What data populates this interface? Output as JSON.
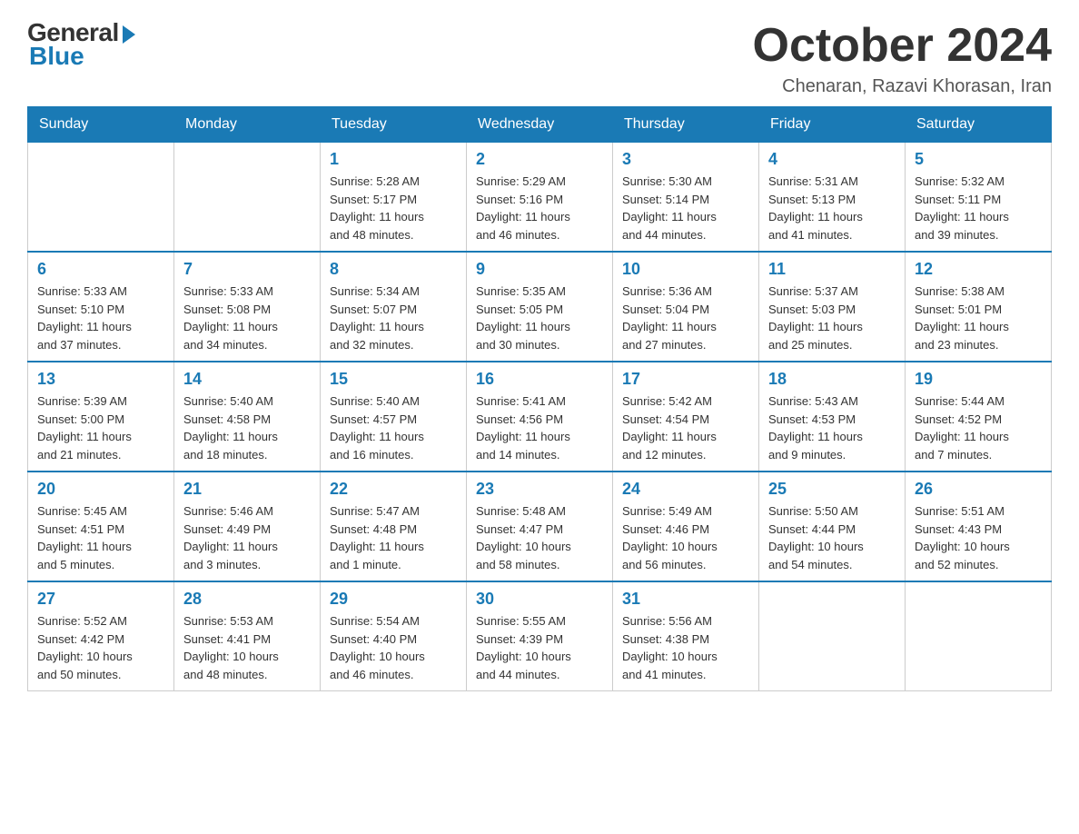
{
  "logo": {
    "general": "General",
    "blue": "Blue"
  },
  "title": "October 2024",
  "location": "Chenaran, Razavi Khorasan, Iran",
  "days_of_week": [
    "Sunday",
    "Monday",
    "Tuesday",
    "Wednesday",
    "Thursday",
    "Friday",
    "Saturday"
  ],
  "weeks": [
    [
      {
        "day": "",
        "info": ""
      },
      {
        "day": "",
        "info": ""
      },
      {
        "day": "1",
        "info": "Sunrise: 5:28 AM\nSunset: 5:17 PM\nDaylight: 11 hours\nand 48 minutes."
      },
      {
        "day": "2",
        "info": "Sunrise: 5:29 AM\nSunset: 5:16 PM\nDaylight: 11 hours\nand 46 minutes."
      },
      {
        "day": "3",
        "info": "Sunrise: 5:30 AM\nSunset: 5:14 PM\nDaylight: 11 hours\nand 44 minutes."
      },
      {
        "day": "4",
        "info": "Sunrise: 5:31 AM\nSunset: 5:13 PM\nDaylight: 11 hours\nand 41 minutes."
      },
      {
        "day": "5",
        "info": "Sunrise: 5:32 AM\nSunset: 5:11 PM\nDaylight: 11 hours\nand 39 minutes."
      }
    ],
    [
      {
        "day": "6",
        "info": "Sunrise: 5:33 AM\nSunset: 5:10 PM\nDaylight: 11 hours\nand 37 minutes."
      },
      {
        "day": "7",
        "info": "Sunrise: 5:33 AM\nSunset: 5:08 PM\nDaylight: 11 hours\nand 34 minutes."
      },
      {
        "day": "8",
        "info": "Sunrise: 5:34 AM\nSunset: 5:07 PM\nDaylight: 11 hours\nand 32 minutes."
      },
      {
        "day": "9",
        "info": "Sunrise: 5:35 AM\nSunset: 5:05 PM\nDaylight: 11 hours\nand 30 minutes."
      },
      {
        "day": "10",
        "info": "Sunrise: 5:36 AM\nSunset: 5:04 PM\nDaylight: 11 hours\nand 27 minutes."
      },
      {
        "day": "11",
        "info": "Sunrise: 5:37 AM\nSunset: 5:03 PM\nDaylight: 11 hours\nand 25 minutes."
      },
      {
        "day": "12",
        "info": "Sunrise: 5:38 AM\nSunset: 5:01 PM\nDaylight: 11 hours\nand 23 minutes."
      }
    ],
    [
      {
        "day": "13",
        "info": "Sunrise: 5:39 AM\nSunset: 5:00 PM\nDaylight: 11 hours\nand 21 minutes."
      },
      {
        "day": "14",
        "info": "Sunrise: 5:40 AM\nSunset: 4:58 PM\nDaylight: 11 hours\nand 18 minutes."
      },
      {
        "day": "15",
        "info": "Sunrise: 5:40 AM\nSunset: 4:57 PM\nDaylight: 11 hours\nand 16 minutes."
      },
      {
        "day": "16",
        "info": "Sunrise: 5:41 AM\nSunset: 4:56 PM\nDaylight: 11 hours\nand 14 minutes."
      },
      {
        "day": "17",
        "info": "Sunrise: 5:42 AM\nSunset: 4:54 PM\nDaylight: 11 hours\nand 12 minutes."
      },
      {
        "day": "18",
        "info": "Sunrise: 5:43 AM\nSunset: 4:53 PM\nDaylight: 11 hours\nand 9 minutes."
      },
      {
        "day": "19",
        "info": "Sunrise: 5:44 AM\nSunset: 4:52 PM\nDaylight: 11 hours\nand 7 minutes."
      }
    ],
    [
      {
        "day": "20",
        "info": "Sunrise: 5:45 AM\nSunset: 4:51 PM\nDaylight: 11 hours\nand 5 minutes."
      },
      {
        "day": "21",
        "info": "Sunrise: 5:46 AM\nSunset: 4:49 PM\nDaylight: 11 hours\nand 3 minutes."
      },
      {
        "day": "22",
        "info": "Sunrise: 5:47 AM\nSunset: 4:48 PM\nDaylight: 11 hours\nand 1 minute."
      },
      {
        "day": "23",
        "info": "Sunrise: 5:48 AM\nSunset: 4:47 PM\nDaylight: 10 hours\nand 58 minutes."
      },
      {
        "day": "24",
        "info": "Sunrise: 5:49 AM\nSunset: 4:46 PM\nDaylight: 10 hours\nand 56 minutes."
      },
      {
        "day": "25",
        "info": "Sunrise: 5:50 AM\nSunset: 4:44 PM\nDaylight: 10 hours\nand 54 minutes."
      },
      {
        "day": "26",
        "info": "Sunrise: 5:51 AM\nSunset: 4:43 PM\nDaylight: 10 hours\nand 52 minutes."
      }
    ],
    [
      {
        "day": "27",
        "info": "Sunrise: 5:52 AM\nSunset: 4:42 PM\nDaylight: 10 hours\nand 50 minutes."
      },
      {
        "day": "28",
        "info": "Sunrise: 5:53 AM\nSunset: 4:41 PM\nDaylight: 10 hours\nand 48 minutes."
      },
      {
        "day": "29",
        "info": "Sunrise: 5:54 AM\nSunset: 4:40 PM\nDaylight: 10 hours\nand 46 minutes."
      },
      {
        "day": "30",
        "info": "Sunrise: 5:55 AM\nSunset: 4:39 PM\nDaylight: 10 hours\nand 44 minutes."
      },
      {
        "day": "31",
        "info": "Sunrise: 5:56 AM\nSunset: 4:38 PM\nDaylight: 10 hours\nand 41 minutes."
      },
      {
        "day": "",
        "info": ""
      },
      {
        "day": "",
        "info": ""
      }
    ]
  ]
}
